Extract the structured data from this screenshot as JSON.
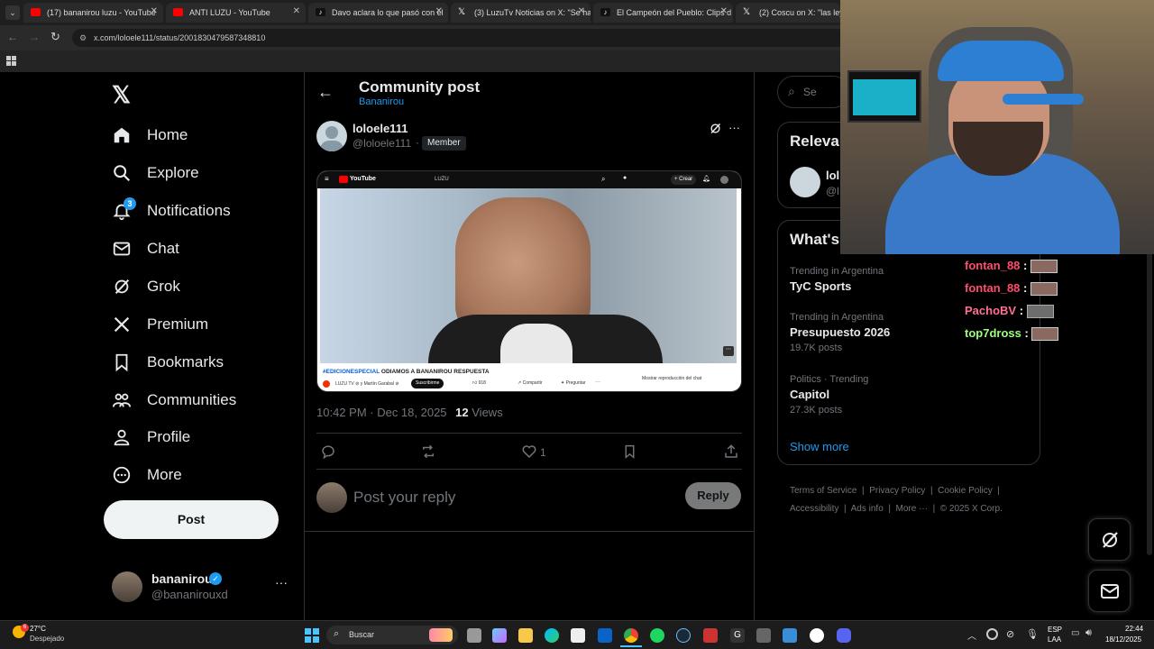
{
  "browser": {
    "tabs": [
      {
        "title": "(17) bananirou luzu - YouTube",
        "color": "#ff0000"
      },
      {
        "title": "ANTI LUZU - YouTube",
        "color": "#ff0000"
      },
      {
        "title": "Davo aclara lo que pasó con el",
        "color": "#111111"
      },
      {
        "title": "(3) LuzuTv Noticias on X: \"Se ha",
        "color": "#111111"
      },
      {
        "title": "El Campeón del Pueblo: Clips d",
        "color": "#111111"
      },
      {
        "title": "(2) Coscu on X: \"las leyes d",
        "color": "#111111"
      }
    ],
    "url": "x.com/loloele111/status/2001830479587348810"
  },
  "nav": {
    "items": [
      "Home",
      "Explore",
      "Notifications",
      "Chat",
      "Grok",
      "Premium",
      "Bookmarks",
      "Communities",
      "Profile",
      "More"
    ],
    "notification_badge": "3",
    "post_label": "Post"
  },
  "account": {
    "name": "bananirou",
    "handle": "@bananirouxd"
  },
  "post": {
    "header_title": "Community post",
    "community": "Bananirou",
    "author_name": "loloele111",
    "author_handle": "@loloele111",
    "member_badge": "Member",
    "timestamp": "10:42 PM · Dec 18, 2025",
    "views_count": "12",
    "views_label": "Views",
    "likes": "1",
    "reply_placeholder": "Post your reply",
    "reply_button": "Reply",
    "embedded": {
      "yt_logo": "YouTube",
      "search_text": "LUZU",
      "create_label": "Crear",
      "video_title_tag": "#EDICIONESPECIAL",
      "video_title_rest": " ODIAMOS A BANANIROU RESPUESTA",
      "channel": "LUZU TV ⊘ y Martín Garabal ⊘",
      "subscribe": "Suscribirme",
      "likes": "918",
      "share": "Compartir",
      "ask": "Preguntar",
      "chat_replay": "Mostrar reproducción del chat"
    }
  },
  "sidebar": {
    "search_placeholder": "Se",
    "relevant_title": "Releva",
    "relevant_name": "lol",
    "relevant_handle": "@l",
    "whats_title": "What's",
    "trends": [
      {
        "category": "Trending in Argentina",
        "name": "TyC Sports",
        "count": ""
      },
      {
        "category": "Trending in Argentina",
        "name": "Presupuesto 2026",
        "count": "19.7K posts"
      },
      {
        "category": "Politics · Trending",
        "name": "Capitol",
        "count": "27.3K posts"
      }
    ],
    "show_more": "Show more",
    "footer": [
      "Terms of Service",
      "Privacy Policy",
      "Cookie Policy",
      "Accessibility",
      "Ads info",
      "More ···",
      "© 2025 X Corp."
    ]
  },
  "stream_chat": [
    {
      "user": "fontan_88",
      "color": "#ff4d6d"
    },
    {
      "user": "fontan_88",
      "color": "#ff4d6d"
    },
    {
      "user": "PachoBV",
      "color": "#ff6f91"
    },
    {
      "user": "top7dross",
      "color": "#9dff7a"
    }
  ],
  "taskbar": {
    "temp": "27°C",
    "weather": "Despejado",
    "search_label": "Buscar",
    "lang_top": "ESP",
    "lang_bottom": "LAA",
    "time": "22:44",
    "date": "18/12/2025",
    "weather_badge": "6"
  },
  "colors": {
    "accent": "#1d9bf0",
    "bg": "#000000",
    "border": "#2f3336",
    "muted": "#71767b"
  }
}
